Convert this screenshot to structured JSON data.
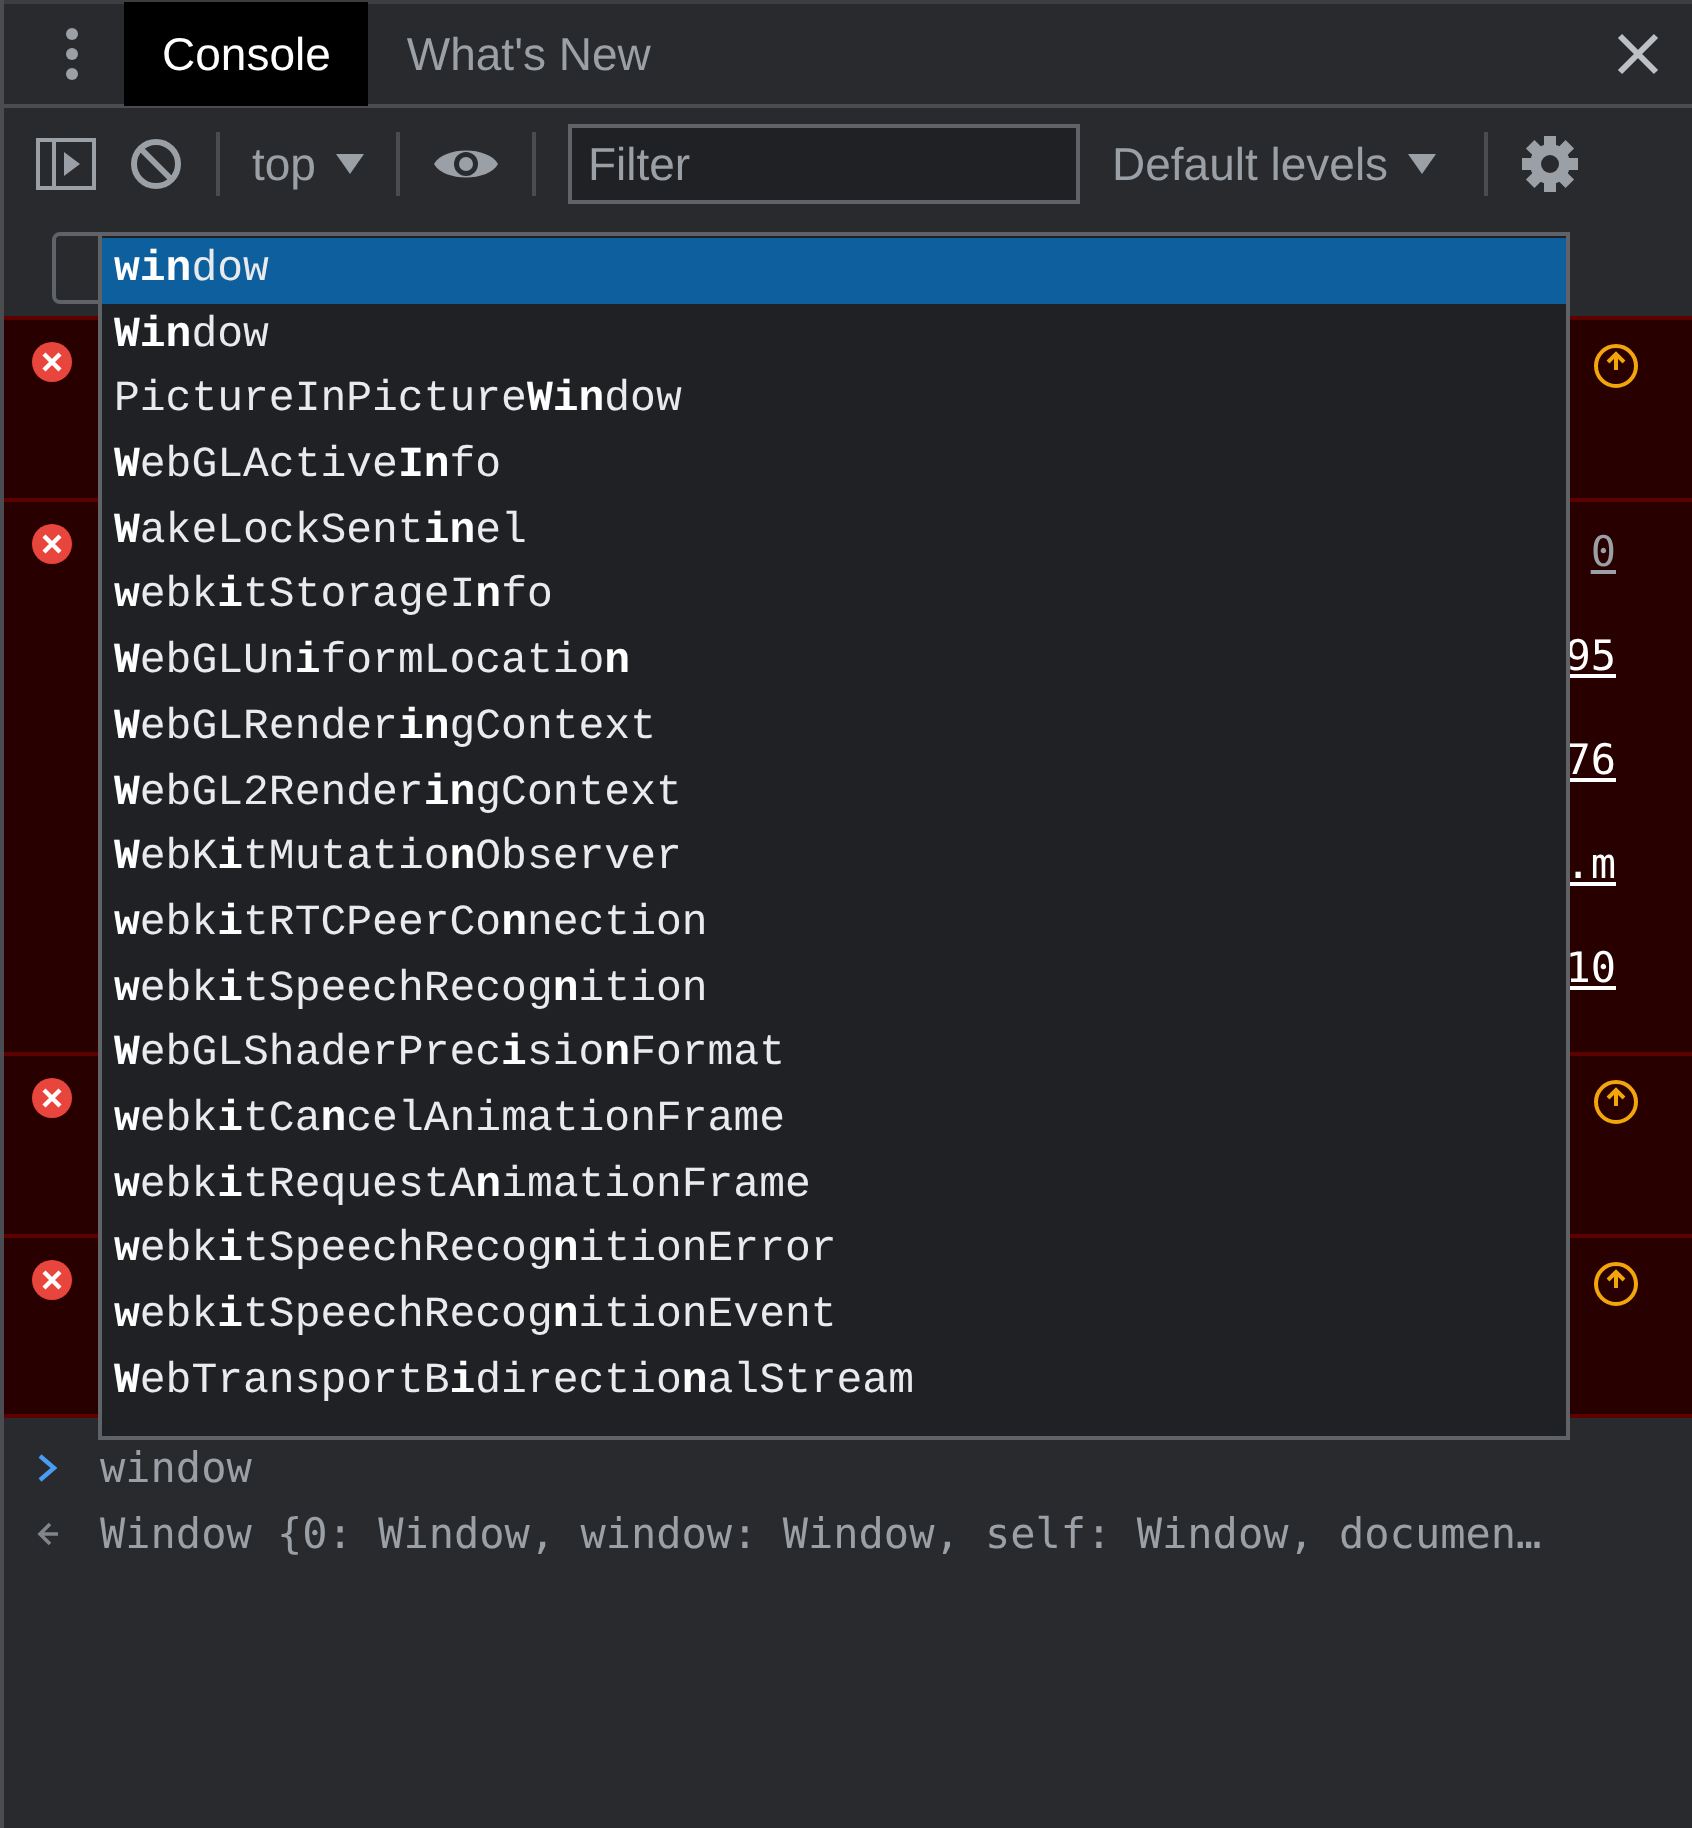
{
  "tabs": [
    {
      "label": "Console",
      "selected": true
    },
    {
      "label": "What's New",
      "selected": false
    }
  ],
  "toolbar": {
    "context": "top",
    "filter": {
      "placeholder": "Filter"
    },
    "levels": "Default levels"
  },
  "messages": [
    {
      "kind": "error",
      "warning_icon": true
    },
    {
      "kind": "error",
      "links": [
        "0",
        "95",
        "76",
        ".m",
        "10"
      ],
      "warning_icon": false
    },
    {
      "kind": "error",
      "warning_icon": true
    },
    {
      "kind": "error",
      "warning_icon": true
    }
  ],
  "autocomplete": [
    {
      "text": "**win**dow",
      "selected": true
    },
    {
      "text": "**Win**dow",
      "selected": false
    },
    {
      "text": "PictureInPicture**Win**dow",
      "selected": false
    },
    {
      "text": "**W**ebGLActive**In**fo",
      "selected": false
    },
    {
      "text": "**W**akeLockSent**in**el",
      "selected": false
    },
    {
      "text": "**w**ebk**i**tStorageI**n**fo",
      "selected": false
    },
    {
      "text": "**W**ebGLUn**i**formLocatio**n**",
      "selected": false
    },
    {
      "text": "**W**ebGLRender**in**gContext",
      "selected": false
    },
    {
      "text": "**W**ebGL2Render**in**gContext",
      "selected": false
    },
    {
      "text": "**W**ebK**i**tMutatio**n**Observer",
      "selected": false
    },
    {
      "text": "**w**ebk**i**tRTCPeerCo**n**nection",
      "selected": false
    },
    {
      "text": "**w**ebk**i**tSpeechRecog**n**ition",
      "selected": false
    },
    {
      "text": "**W**ebGLShaderPrec**i**sio**n**Format",
      "selected": false
    },
    {
      "text": "**w**ebk**i**tCa**n**celAnimationFrame",
      "selected": false
    },
    {
      "text": "**w**ebk**i**tRequestA**n**imationFrame",
      "selected": false
    },
    {
      "text": "**w**ebk**i**tSpeechRecog**n**itionError",
      "selected": false
    },
    {
      "text": "**w**ebk**i**tSpeechRecog**n**itionEvent",
      "selected": false
    },
    {
      "text": "**W**ebTransportB**i**directio**n**alStream",
      "selected": false
    }
  ],
  "prompt": {
    "input": "window",
    "result": "Window {0: Window, window: Window, self: Window, documen…"
  }
}
